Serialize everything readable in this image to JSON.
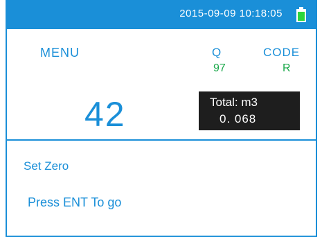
{
  "statusbar": {
    "datetime": "2015-09-09 10:18:05",
    "battery_icon": "battery-icon",
    "battery_level": 0.85
  },
  "main": {
    "menu_label": "MENU",
    "q_label": "Q",
    "q_value": "97",
    "code_label": "CODE",
    "code_value": "R",
    "big_number": "42",
    "total_label": "Total: m3",
    "total_value": "0. 068"
  },
  "bottom": {
    "set_zero": "Set Zero",
    "press_ent": "Press ENT To go"
  },
  "colors": {
    "accent_blue": "#1a8fd8",
    "value_green": "#1aa84a",
    "battery_green": "#2bd63c",
    "total_box_bg": "#1e1e1e"
  }
}
